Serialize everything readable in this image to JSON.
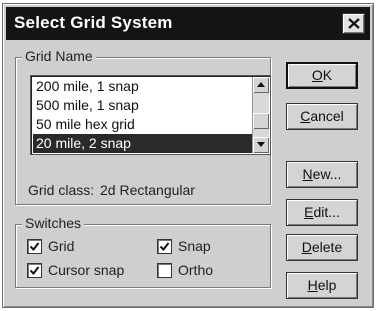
{
  "dialog": {
    "title": "Select Grid System",
    "close_glyph": "close-icon"
  },
  "grid_name": {
    "legend": "Grid Name",
    "items": [
      {
        "label": "200 mile, 1 snap",
        "selected": false
      },
      {
        "label": "500 mile, 1 snap",
        "selected": false
      },
      {
        "label": "50 mile hex grid",
        "selected": false
      },
      {
        "label": "20 mile, 2 snap",
        "selected": true
      }
    ],
    "scroll_up_icon": "arrow-up-icon",
    "scroll_down_icon": "arrow-down-icon",
    "grid_class_label": "Grid class:",
    "grid_class_value": "2d Rectangular"
  },
  "switches": {
    "legend": "Switches",
    "items": [
      {
        "label": "Grid",
        "checked": true
      },
      {
        "label": "Snap",
        "checked": true
      },
      {
        "label": "Cursor snap",
        "checked": true
      },
      {
        "label": "Ortho",
        "checked": false
      }
    ]
  },
  "buttons": {
    "ok": {
      "mnemonic": "O",
      "rest": "K"
    },
    "cancel": {
      "mnemonic": "C",
      "rest": "ancel"
    },
    "new": {
      "mnemonic": "N",
      "rest": "ew..."
    },
    "edit": {
      "mnemonic": "E",
      "rest": "dit..."
    },
    "delete": {
      "mnemonic": "D",
      "rest": "elete"
    },
    "help": {
      "mnemonic": "H",
      "rest": "elp"
    }
  }
}
